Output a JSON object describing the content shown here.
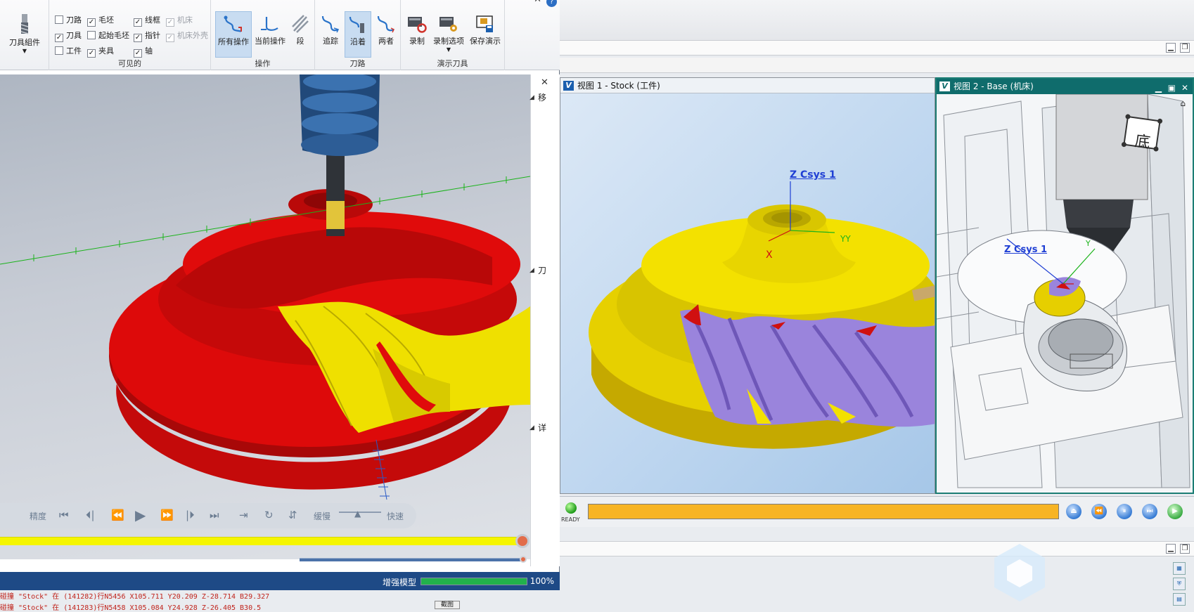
{
  "ribbon": {
    "tool_component": {
      "label": "刀具組件"
    },
    "visible_group": {
      "title": "可见的",
      "checks": [
        {
          "label": "刀路",
          "checked": false,
          "disabled": false
        },
        {
          "label": "毛坯",
          "checked": true,
          "disabled": false
        },
        {
          "label": "线框",
          "checked": true,
          "disabled": false
        },
        {
          "label": "机床",
          "checked": true,
          "disabled": true
        },
        {
          "label": "刀具",
          "checked": true,
          "disabled": false
        },
        {
          "label": "起始毛坯",
          "checked": false,
          "disabled": false
        },
        {
          "label": "指针",
          "checked": true,
          "disabled": false
        },
        {
          "label": "机床外壳",
          "checked": true,
          "disabled": true
        },
        {
          "label": "工件",
          "checked": false,
          "disabled": false
        },
        {
          "label": "夹具",
          "checked": true,
          "disabled": false
        },
        {
          "label": "轴",
          "checked": true,
          "disabled": false
        }
      ]
    },
    "operations_group": {
      "title": "操作",
      "all_ops": "所有操作",
      "current_op": "当前操作",
      "segment": "段"
    },
    "toolpath_group": {
      "title": "刀路",
      "trace": "追踪",
      "along": "沿着",
      "both": "两者"
    },
    "demo_group": {
      "title": "演示刀具",
      "record": "录制",
      "record_opts": "录制选项",
      "save_demo": "保存演示"
    }
  },
  "right_panel": {
    "labels": [
      "移",
      "刀",
      "详"
    ]
  },
  "playbar": {
    "precision": "精度",
    "slow": "缓慢",
    "fast": "快速"
  },
  "status": {
    "text": "增强模型",
    "percent": "100%",
    "progress": 1.0
  },
  "log": {
    "line1": "碰撞 \"Stock\" 在 (141282)行N5456 X105.711 Y20.209 Z-28.714 B29.327",
    "line2": "碰撞 \"Stock\" 在 (141283)行N5458 X105.084 Y24.928 Z-26.405 B30.5",
    "button": "截图"
  },
  "view1": {
    "title": "视图 1 - Stock (工件)",
    "csys_label": "Z Csys 1",
    "x_axis": "X",
    "y_axis": "YY"
  },
  "view2": {
    "title": "视图 2 - Base (机床)",
    "csys_label": "Z Csys 1",
    "y_axis": "Y",
    "view_cube_face": "底"
  },
  "controls": {
    "ready": "READY",
    "progress": 1.0
  },
  "colors": {
    "stock_red": "#dd0a0a",
    "stock_yellow": "#f0e400",
    "cut_purple": "#9a84dc",
    "status_blue": "#1e4a86",
    "view2_title": "#0f6c6c"
  }
}
